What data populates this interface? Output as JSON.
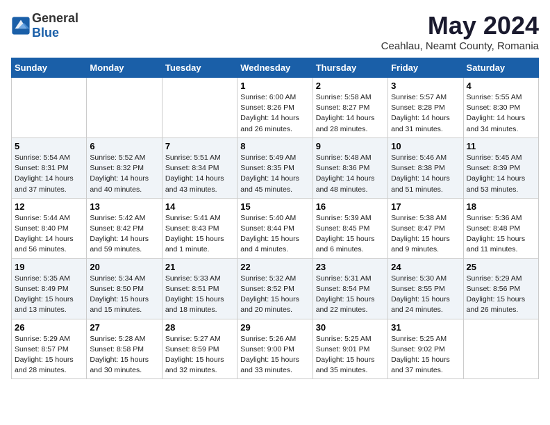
{
  "logo": {
    "general": "General",
    "blue": "Blue"
  },
  "title": "May 2024",
  "subtitle": "Ceahlau, Neamt County, Romania",
  "days_header": [
    "Sunday",
    "Monday",
    "Tuesday",
    "Wednesday",
    "Thursday",
    "Friday",
    "Saturday"
  ],
  "weeks": [
    [
      {
        "day": "",
        "info": ""
      },
      {
        "day": "",
        "info": ""
      },
      {
        "day": "",
        "info": ""
      },
      {
        "day": "1",
        "info": "Sunrise: 6:00 AM\nSunset: 8:26 PM\nDaylight: 14 hours\nand 26 minutes."
      },
      {
        "day": "2",
        "info": "Sunrise: 5:58 AM\nSunset: 8:27 PM\nDaylight: 14 hours\nand 28 minutes."
      },
      {
        "day": "3",
        "info": "Sunrise: 5:57 AM\nSunset: 8:28 PM\nDaylight: 14 hours\nand 31 minutes."
      },
      {
        "day": "4",
        "info": "Sunrise: 5:55 AM\nSunset: 8:30 PM\nDaylight: 14 hours\nand 34 minutes."
      }
    ],
    [
      {
        "day": "5",
        "info": "Sunrise: 5:54 AM\nSunset: 8:31 PM\nDaylight: 14 hours\nand 37 minutes."
      },
      {
        "day": "6",
        "info": "Sunrise: 5:52 AM\nSunset: 8:32 PM\nDaylight: 14 hours\nand 40 minutes."
      },
      {
        "day": "7",
        "info": "Sunrise: 5:51 AM\nSunset: 8:34 PM\nDaylight: 14 hours\nand 43 minutes."
      },
      {
        "day": "8",
        "info": "Sunrise: 5:49 AM\nSunset: 8:35 PM\nDaylight: 14 hours\nand 45 minutes."
      },
      {
        "day": "9",
        "info": "Sunrise: 5:48 AM\nSunset: 8:36 PM\nDaylight: 14 hours\nand 48 minutes."
      },
      {
        "day": "10",
        "info": "Sunrise: 5:46 AM\nSunset: 8:38 PM\nDaylight: 14 hours\nand 51 minutes."
      },
      {
        "day": "11",
        "info": "Sunrise: 5:45 AM\nSunset: 8:39 PM\nDaylight: 14 hours\nand 53 minutes."
      }
    ],
    [
      {
        "day": "12",
        "info": "Sunrise: 5:44 AM\nSunset: 8:40 PM\nDaylight: 14 hours\nand 56 minutes."
      },
      {
        "day": "13",
        "info": "Sunrise: 5:42 AM\nSunset: 8:42 PM\nDaylight: 14 hours\nand 59 minutes."
      },
      {
        "day": "14",
        "info": "Sunrise: 5:41 AM\nSunset: 8:43 PM\nDaylight: 15 hours\nand 1 minute."
      },
      {
        "day": "15",
        "info": "Sunrise: 5:40 AM\nSunset: 8:44 PM\nDaylight: 15 hours\nand 4 minutes."
      },
      {
        "day": "16",
        "info": "Sunrise: 5:39 AM\nSunset: 8:45 PM\nDaylight: 15 hours\nand 6 minutes."
      },
      {
        "day": "17",
        "info": "Sunrise: 5:38 AM\nSunset: 8:47 PM\nDaylight: 15 hours\nand 9 minutes."
      },
      {
        "day": "18",
        "info": "Sunrise: 5:36 AM\nSunset: 8:48 PM\nDaylight: 15 hours\nand 11 minutes."
      }
    ],
    [
      {
        "day": "19",
        "info": "Sunrise: 5:35 AM\nSunset: 8:49 PM\nDaylight: 15 hours\nand 13 minutes."
      },
      {
        "day": "20",
        "info": "Sunrise: 5:34 AM\nSunset: 8:50 PM\nDaylight: 15 hours\nand 15 minutes."
      },
      {
        "day": "21",
        "info": "Sunrise: 5:33 AM\nSunset: 8:51 PM\nDaylight: 15 hours\nand 18 minutes."
      },
      {
        "day": "22",
        "info": "Sunrise: 5:32 AM\nSunset: 8:52 PM\nDaylight: 15 hours\nand 20 minutes."
      },
      {
        "day": "23",
        "info": "Sunrise: 5:31 AM\nSunset: 8:54 PM\nDaylight: 15 hours\nand 22 minutes."
      },
      {
        "day": "24",
        "info": "Sunrise: 5:30 AM\nSunset: 8:55 PM\nDaylight: 15 hours\nand 24 minutes."
      },
      {
        "day": "25",
        "info": "Sunrise: 5:29 AM\nSunset: 8:56 PM\nDaylight: 15 hours\nand 26 minutes."
      }
    ],
    [
      {
        "day": "26",
        "info": "Sunrise: 5:29 AM\nSunset: 8:57 PM\nDaylight: 15 hours\nand 28 minutes."
      },
      {
        "day": "27",
        "info": "Sunrise: 5:28 AM\nSunset: 8:58 PM\nDaylight: 15 hours\nand 30 minutes."
      },
      {
        "day": "28",
        "info": "Sunrise: 5:27 AM\nSunset: 8:59 PM\nDaylight: 15 hours\nand 32 minutes."
      },
      {
        "day": "29",
        "info": "Sunrise: 5:26 AM\nSunset: 9:00 PM\nDaylight: 15 hours\nand 33 minutes."
      },
      {
        "day": "30",
        "info": "Sunrise: 5:25 AM\nSunset: 9:01 PM\nDaylight: 15 hours\nand 35 minutes."
      },
      {
        "day": "31",
        "info": "Sunrise: 5:25 AM\nSunset: 9:02 PM\nDaylight: 15 hours\nand 37 minutes."
      },
      {
        "day": "",
        "info": ""
      }
    ]
  ]
}
